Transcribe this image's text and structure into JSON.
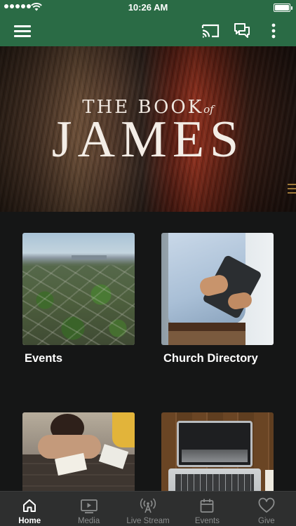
{
  "status_bar": {
    "time": "10:26 AM"
  },
  "app_bar": {
    "menu_icon": "hamburger-menu-icon",
    "actions": [
      "cast-icon",
      "chat-bubbles-icon",
      "more-vertical-icon"
    ]
  },
  "hero": {
    "title_prefix": "THE BOOK",
    "title_of": "of",
    "title_main": "JAMES"
  },
  "tiles": [
    {
      "label": "Events",
      "image": "aerial-city-photo"
    },
    {
      "label": "Church Directory",
      "image": "man-holding-tablet-photo"
    },
    {
      "label": "",
      "image": "people-studying-photo"
    },
    {
      "label": "",
      "image": "laptop-on-desk-photo"
    }
  ],
  "tab_bar": {
    "items": [
      {
        "label": "Home",
        "icon": "home-icon",
        "active": true
      },
      {
        "label": "Media",
        "icon": "media-play-icon",
        "active": false
      },
      {
        "label": "Live Stream",
        "icon": "live-stream-antenna-icon",
        "active": false
      },
      {
        "label": "Events",
        "icon": "calendar-icon",
        "active": false
      },
      {
        "label": "Give",
        "icon": "heart-icon",
        "active": false
      }
    ]
  },
  "colors": {
    "brand_green": "#2a6b45",
    "background": "#151616",
    "tab_bar": "#2e2f2f",
    "tab_inactive": "#8b8d8d"
  }
}
